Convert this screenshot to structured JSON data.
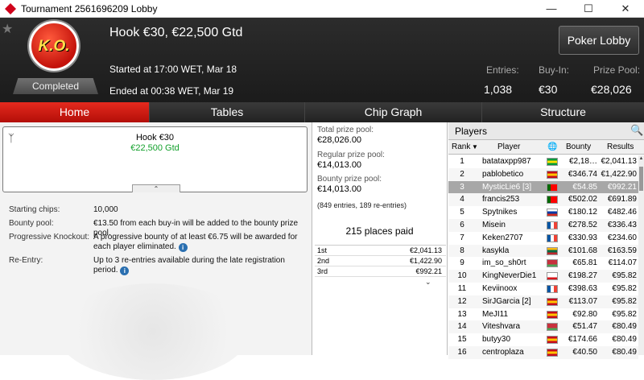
{
  "window": {
    "title": "Tournament 2561696209 Lobby"
  },
  "header": {
    "badge_text": "K.O.",
    "status": "Completed",
    "name": "Hook €30, €22,500 Gtd",
    "started": "Started at 17:00 WET, Mar 18",
    "ended": "Ended at 00:38 WET, Mar 19",
    "poker_lobby": "Poker Lobby",
    "stats": [
      {
        "label": "Entries:",
        "value": "1,038"
      },
      {
        "label": "Buy-In:",
        "value": "€30"
      },
      {
        "label": "Prize Pool:",
        "value": "€28,026"
      }
    ]
  },
  "tabs": [
    {
      "label": "Home",
      "active": true
    },
    {
      "label": "Tables",
      "active": false
    },
    {
      "label": "Chip Graph",
      "active": false
    },
    {
      "label": "Structure",
      "active": false
    }
  ],
  "summary": {
    "name": "Hook €30",
    "gtd": "€22,500 Gtd"
  },
  "details": [
    {
      "label": "Starting chips:",
      "value": "10,000",
      "info": false
    },
    {
      "label": "Bounty pool:",
      "value": "€13.50 from each buy-in will be added to the bounty prize pool.",
      "info": false
    },
    {
      "label": "Progressive Knockout:",
      "value": "A progressive bounty of at least €6.75 will be awarded for each player eliminated.",
      "info": true
    },
    {
      "label": "Re-Entry:",
      "value": "Up to 3 re-entries available during the late registration period.",
      "info": true
    }
  ],
  "prizes": {
    "total_label": "Total prize pool:",
    "total_value": "€28,026.00",
    "regular_label": "Regular prize pool:",
    "regular_value": "€14,013.00",
    "bounty_label": "Bounty prize pool:",
    "bounty_value": "€14,013.00",
    "entries_note": "(849 entries, 189 re-entries)",
    "places_paid": "215 places paid",
    "payouts": [
      {
        "place": "1st",
        "amount": "€2,041.13"
      },
      {
        "place": "2nd",
        "amount": "€1,422.90"
      },
      {
        "place": "3rd",
        "amount": "€992.21"
      }
    ]
  },
  "players": {
    "title": "Players",
    "columns": {
      "rank": "Rank",
      "player": "Player",
      "bounty": "Bounty",
      "results": "Results"
    },
    "rows": [
      {
        "rank": "1",
        "name": "batataxpp987",
        "flag": "br",
        "bounty": "€2,18…",
        "results": "€2,041.13"
      },
      {
        "rank": "2",
        "name": "pablobetico",
        "flag": "es",
        "bounty": "€346.74",
        "results": "€1,422.90"
      },
      {
        "rank": "3",
        "name": "MysticLie6 [3]",
        "flag": "pt",
        "bounty": "€54.85",
        "results": "€992.21",
        "selected": true
      },
      {
        "rank": "4",
        "name": "francis253",
        "flag": "pt",
        "bounty": "€502.02",
        "results": "€691.89"
      },
      {
        "rank": "5",
        "name": "Spytnikes",
        "flag": "ru",
        "bounty": "€180.12",
        "results": "€482.46"
      },
      {
        "rank": "6",
        "name": "Misein",
        "flag": "fr",
        "bounty": "€278.52",
        "results": "€336.43"
      },
      {
        "rank": "7",
        "name": "Keken2707",
        "flag": "fr",
        "bounty": "€330.93",
        "results": "€234.60"
      },
      {
        "rank": "8",
        "name": "kasykla",
        "flag": "lt",
        "bounty": "€101.68",
        "results": "€163.59"
      },
      {
        "rank": "9",
        "name": "im_so_sh0rt",
        "flag": "by",
        "bounty": "€65.81",
        "results": "€114.07"
      },
      {
        "rank": "10",
        "name": "KingNeverDie1",
        "flag": "cz",
        "bounty": "€198.27",
        "results": "€95.82"
      },
      {
        "rank": "11",
        "name": "Keviinoox",
        "flag": "fr",
        "bounty": "€398.63",
        "results": "€95.82"
      },
      {
        "rank": "12",
        "name": "SirJGarcia [2]",
        "flag": "es",
        "bounty": "€113.07",
        "results": "€95.82"
      },
      {
        "rank": "13",
        "name": "MeJI11",
        "flag": "es",
        "bounty": "€92.80",
        "results": "€95.82"
      },
      {
        "rank": "14",
        "name": "Viteshvara",
        "flag": "by",
        "bounty": "€51.47",
        "results": "€80.49"
      },
      {
        "rank": "15",
        "name": "butyy30",
        "flag": "es",
        "bounty": "€174.66",
        "results": "€80.49"
      },
      {
        "rank": "16",
        "name": "centroplaza",
        "flag": "es",
        "bounty": "€40.50",
        "results": "€80.49"
      }
    ]
  }
}
